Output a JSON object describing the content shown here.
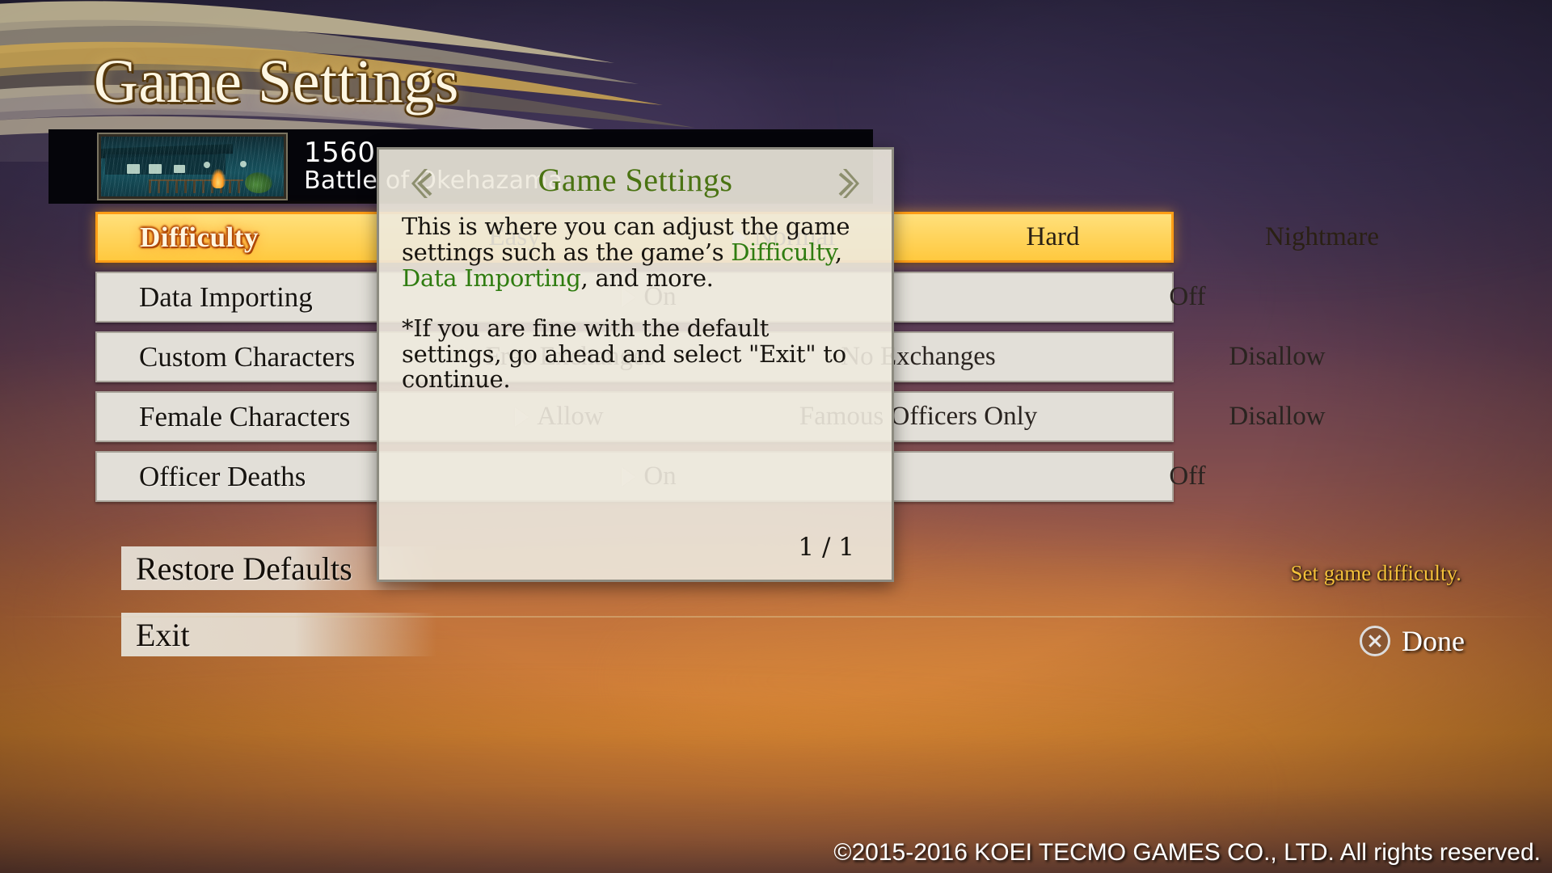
{
  "page_title": "Game Settings",
  "scenario": {
    "year": "1560",
    "name": "Battle of Okehazama",
    "thumbnail_alt": "rainy-village-night-scene"
  },
  "settings_rows": [
    {
      "label": "Difficulty",
      "selected": true,
      "options": [
        "Easy",
        "Normal",
        "Hard",
        "Nightmare"
      ],
      "current": "Normal"
    },
    {
      "label": "Data Importing",
      "selected": false,
      "options": [
        "On",
        "Off"
      ],
      "current": "On"
    },
    {
      "label": "Custom Characters",
      "selected": false,
      "options": [
        "Free Exchanges",
        "No Exchanges",
        "Disallow"
      ],
      "current": "Free Exchanges"
    },
    {
      "label": "Female Characters",
      "selected": false,
      "options": [
        "Allow",
        "Famous Officers Only",
        "Disallow"
      ],
      "current": "Allow"
    },
    {
      "label": "Officer Deaths",
      "selected": false,
      "options": [
        "On",
        "Off"
      ],
      "current": "On"
    }
  ],
  "actions": {
    "restore_defaults": "Restore Defaults",
    "exit": "Exit"
  },
  "hint": "Set game difficulty.",
  "done_button": {
    "label": "Done",
    "icon": "cross-button-icon"
  },
  "copyright": "©2015-2016 KOEI TECMO GAMES CO., LTD. All rights reserved.",
  "help_dialog": {
    "title": "Game Settings",
    "paragraph1": {
      "part1": "This is where you can adjust the game settings such as the game’s ",
      "highlight1": "Difficulty",
      "part2": ", ",
      "highlight2": "Data Importing",
      "part3": ", and more."
    },
    "paragraph2": "*If you are fine with the default settings, go ahead and select \"Exit\" to continue.",
    "page_indicator": "1 / 1",
    "prev_icon": "chevron-left-icon",
    "next_icon": "chevron-right-icon"
  },
  "colors": {
    "accent_gold": "#ffd45c",
    "accent_orange": "#ff9d16",
    "help_green": "#2f7c10",
    "title_green": "#4a7312",
    "hint_yellow": "#f5c13a"
  }
}
